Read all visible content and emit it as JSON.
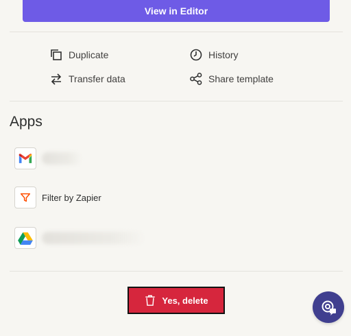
{
  "editor_button": {
    "label": "View in Editor"
  },
  "actions": {
    "duplicate": "Duplicate",
    "history": "History",
    "transfer": "Transfer data",
    "share": "Share template"
  },
  "apps": {
    "heading": "Apps",
    "items": [
      {
        "icon": "gmail-icon",
        "name": ""
      },
      {
        "icon": "filter-icon",
        "name": "Filter by Zapier"
      },
      {
        "icon": "google-drive-icon",
        "name": ""
      }
    ]
  },
  "delete_button": {
    "label": "Yes, delete"
  },
  "colors": {
    "primary": "#6e5be6",
    "danger": "#d6263d",
    "filter_orange": "#ff4f00",
    "fab": "#403f8f"
  },
  "support_button": {
    "icon": "help-chat-icon"
  }
}
